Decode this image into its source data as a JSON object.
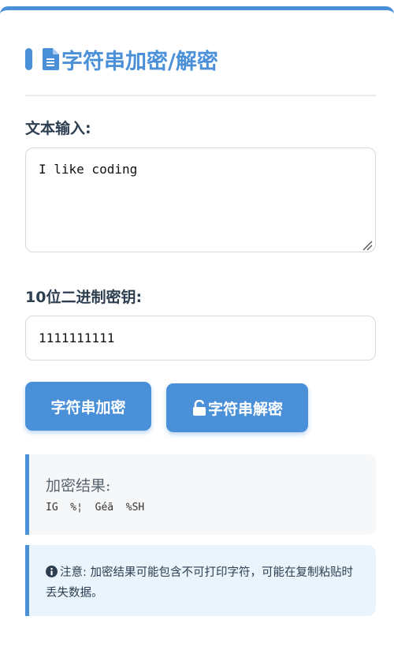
{
  "header": {
    "title": "字符串加密/解密",
    "icon": "document-icon"
  },
  "text_input": {
    "label": "文本输入:",
    "value": "I like coding"
  },
  "key_input": {
    "label": "10位二进制密钥:",
    "value": "1111111111"
  },
  "buttons": {
    "encrypt_label": "字符串加密",
    "decrypt_label": "字符串解密",
    "decrypt_icon": "unlock-icon"
  },
  "result": {
    "title": "加密结果:",
    "value": "IG  %¦  Géã  %SH"
  },
  "note": {
    "icon": "info-circle-icon",
    "text": "注意: 加密结果可能包含不可打印字符，可能在复制粘贴时丢失数据。"
  },
  "colors": {
    "accent": "#4a90d9",
    "text": "#2c3e50",
    "note_background": "#e9f4fc",
    "result_background": "#f5f7f9"
  }
}
